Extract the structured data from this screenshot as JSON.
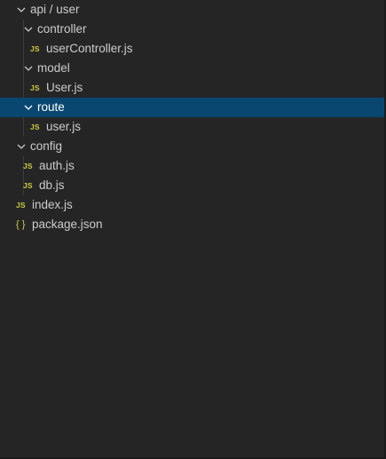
{
  "tree": [
    {
      "label": "api / user",
      "type": "folder",
      "expanded": true
    },
    {
      "label": "controller",
      "type": "folder",
      "expanded": true
    },
    {
      "label": "userController.js",
      "type": "file",
      "icon": "js-file-icon",
      "badge": "JS"
    },
    {
      "label": "model",
      "type": "folder",
      "expanded": true
    },
    {
      "label": "User.js",
      "type": "file",
      "icon": "js-file-icon",
      "badge": "JS"
    },
    {
      "label": "route",
      "type": "folder",
      "expanded": true,
      "selected": true
    },
    {
      "label": "user.js",
      "type": "file",
      "icon": "js-file-icon",
      "badge": "JS"
    },
    {
      "label": "config",
      "type": "folder",
      "expanded": true
    },
    {
      "label": "auth.js",
      "type": "file",
      "icon": "js-file-icon",
      "badge": "JS"
    },
    {
      "label": "db.js",
      "type": "file",
      "icon": "js-file-icon",
      "badge": "JS"
    },
    {
      "label": "index.js",
      "type": "file",
      "icon": "js-file-icon",
      "badge": "JS"
    },
    {
      "label": "package.json",
      "type": "file",
      "icon": "json-file-icon",
      "badge": "{ }"
    }
  ],
  "colors": {
    "background": "#252526",
    "selection": "#094771",
    "text": "#cccccc",
    "js_icon": "#cbcb41"
  }
}
